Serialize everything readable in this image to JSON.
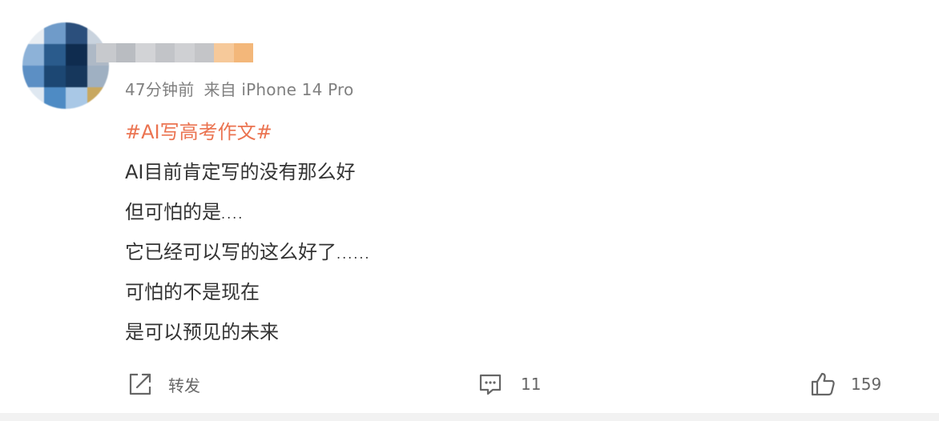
{
  "post": {
    "meta": {
      "time": "47分钟前",
      "source": "来自 iPhone 14 Pro"
    },
    "content": {
      "topic": "#AI写高考作文#",
      "lines": [
        {
          "text": "AI目前肯定写的没有那么好",
          "tail": ""
        },
        {
          "text": "但可怕的是",
          "tail": "...."
        },
        {
          "text": "它已经可以写的这么好了",
          "tail": "......"
        },
        {
          "text": "可怕的不是现在",
          "tail": ""
        },
        {
          "text": "是可以预见的未来",
          "tail": ""
        }
      ]
    },
    "actions": {
      "forward": {
        "icon": "share-icon",
        "label": "转发"
      },
      "comment": {
        "icon": "comment-icon",
        "count": "11"
      },
      "like": {
        "icon": "thumbs-up-icon",
        "count": "159"
      }
    },
    "colors": {
      "topic": "#eb7350",
      "meta": "#808080",
      "text": "#333333",
      "icon": "#666666"
    },
    "avatar": {
      "icon": "avatar"
    },
    "username": {
      "icon": "username"
    }
  }
}
